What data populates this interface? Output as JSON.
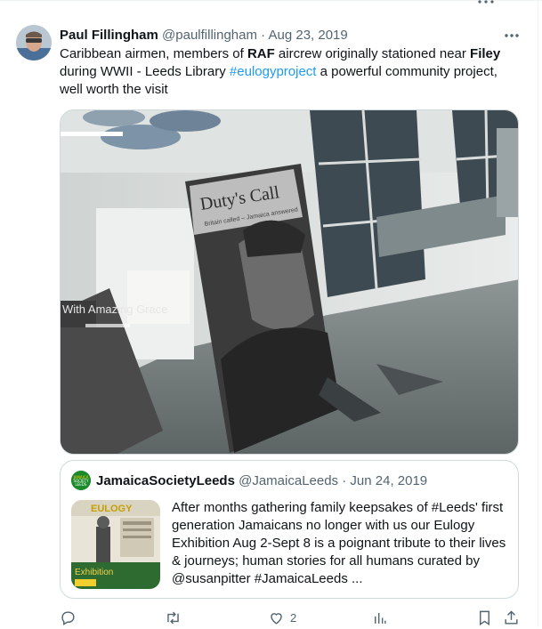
{
  "tweet": {
    "author_name": "Paul Fillingham",
    "handle": "@paulfillingham",
    "separator": "·",
    "date": "Aug 23, 2019",
    "text_parts": [
      {
        "t": "Caribbean airmen, members of ",
        "style": "normal"
      },
      {
        "t": "RAF",
        "style": "bold"
      },
      {
        "t": " aircrew originally stationed near ",
        "style": "normal"
      },
      {
        "t": "Filey",
        "style": "bold"
      },
      {
        "t": " during WWII - Leeds Library ",
        "style": "normal"
      },
      {
        "t": "#eulogyproject",
        "style": "hashtag"
      },
      {
        "t": " a powerful community project, well worth the visit",
        "style": "normal"
      }
    ],
    "media": {
      "banner_title": "Duty's Call",
      "banner_subtitle": "Britain called – Jamaica answered",
      "side_banner_text": "With Amazing Grace"
    }
  },
  "quote": {
    "author_name": "JamaicaSocietyLeeds",
    "handle": "@JamaicaLeeds",
    "separator": "·",
    "date": "Jun 24, 2019",
    "text": "After months gathering family keepsakes of #Leeds' first generation Jamaicans no longer with us our Eulogy Exhibition Aug 2-Sept 8 is a poignant tribute to their lives & journeys; human stories for all humans curated by @susanpitter #JamaicaLeeds  ...",
    "thumb_title": "EULOGY",
    "thumb_label": "Exhibition",
    "avatar_text": "JAMAICA SOCIETY LEEDS"
  },
  "actions": {
    "reply_icon": "reply-icon",
    "retweet_icon": "retweet-icon",
    "like_icon": "heart-icon",
    "like_count": "2",
    "views_icon": "views-icon",
    "bookmark_icon": "bookmark-icon",
    "share_icon": "share-icon"
  },
  "colors": {
    "link": "#1d9bf0",
    "muted": "#536471",
    "border": "#cfd9de",
    "jamaica_green": "#1a8a2a"
  }
}
